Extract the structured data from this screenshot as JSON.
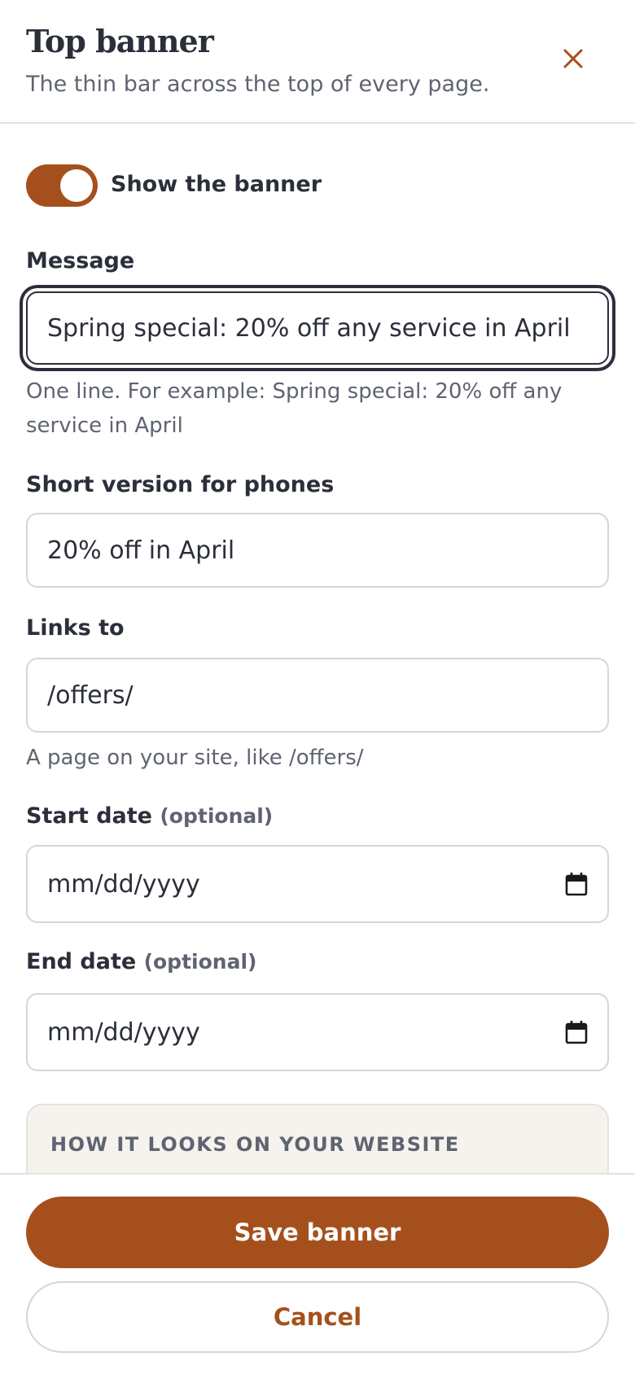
{
  "header": {
    "title": "Top banner",
    "subtitle": "The thin bar across the top of every page.",
    "close_icon": "close-icon"
  },
  "toggle": {
    "label": "Show the banner",
    "on": true
  },
  "message": {
    "label": "Message",
    "value": "Spring special: 20% off any service in April",
    "help": "One line. For example: Spring special: 20% off any service in April"
  },
  "short_version": {
    "label": "Short version for phones",
    "value": "20% off in April"
  },
  "links_to": {
    "label": "Links to",
    "value": "/offers/",
    "help": "A page on your site, like /offers/"
  },
  "start_date": {
    "label": "Start date",
    "optional": "(optional)",
    "placeholder": "mm/dd/yyyy",
    "icon": "calendar-icon"
  },
  "end_date": {
    "label": "End date",
    "optional": "(optional)",
    "placeholder": "mm/dd/yyyy",
    "icon": "calendar-icon"
  },
  "preview": {
    "heading": "HOW IT LOOKS ON YOUR WEBSITE"
  },
  "footer": {
    "save_label": "Save banner",
    "cancel_label": "Cancel"
  },
  "colors": {
    "accent": "#a5501c",
    "text": "#2b2f3a",
    "muted": "#5f6470",
    "preview_bg": "#f6f3ee"
  }
}
